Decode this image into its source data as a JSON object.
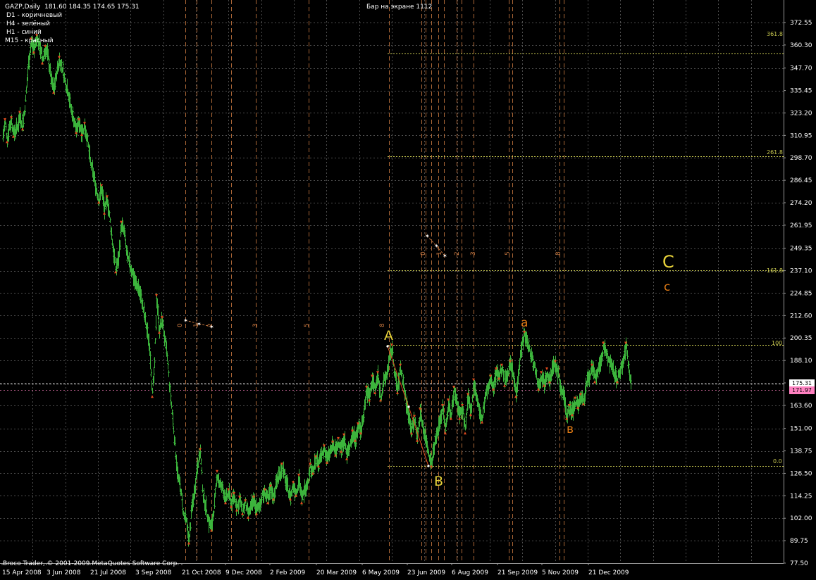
{
  "window": {
    "symbol": "GAZP,Daily",
    "ohlc": "181.60 184.35 174.65 175.31",
    "bars_on_screen": "Бар на экране 1112",
    "watermark": "Broco Trader, © 2001-2009 MetaQuotes Software Corp."
  },
  "legend": [
    {
      "label": "D1 - коричневый"
    },
    {
      "label": "H4 - зелёный"
    },
    {
      "label": "H1 - синий"
    },
    {
      "label": "M15 - красный"
    }
  ],
  "colors": {
    "background": "#000000",
    "grid": "#4d4d4d",
    "bull_bar": "#3cb43c",
    "fractal_marker": "#e04a1e",
    "fib_line": "#c8c850",
    "cycle_line": "#c87840",
    "wave_yellow": "#e8d23a",
    "wave_orange": "#e07a14",
    "current_price_box": "#ffffff",
    "secondary_price_box": "#ff80c0"
  },
  "price_boxes": {
    "current": "175.31",
    "secondary": "171.97"
  },
  "fib_levels": [
    {
      "label": "361.8",
      "price": 355.5
    },
    {
      "label": "261.8",
      "price": 299.5
    },
    {
      "label": "161.8",
      "price": 237.5
    },
    {
      "label": "100",
      "price": 196.5
    },
    {
      "label": "0.0",
      "price": 130.5
    }
  ],
  "wave_labels": [
    {
      "text": "A",
      "style": "big-yellow"
    },
    {
      "text": "B",
      "style": "big-yellow"
    },
    {
      "text": "C",
      "style": "big-yellow"
    },
    {
      "text": "a",
      "style": "small-orange"
    },
    {
      "text": "в",
      "style": "small-orange"
    },
    {
      "text": "c",
      "style": "small-orange"
    }
  ],
  "cycle_numbers_1": [
    "0",
    "1",
    "2",
    "3",
    "5"
  ],
  "cycle_numbers_2": [
    "8"
  ],
  "cycle_numbers_3": [
    "0",
    "1",
    "2",
    "3",
    "5",
    "8"
  ],
  "chart_data": {
    "type": "bar",
    "y_ticks": [
      372.55,
      360.3,
      347.7,
      335.45,
      323.2,
      310.95,
      298.7,
      286.45,
      274.2,
      261.95,
      249.35,
      237.1,
      224.85,
      212.6,
      200.35,
      188.1,
      175.85,
      163.6,
      151.0,
      138.75,
      126.5,
      114.25,
      102.0,
      89.75,
      77.5
    ],
    "x_ticks": [
      "15 Apr 2008",
      "3 Jun 2008",
      "21 Jul 2008",
      "3 Sep 2008",
      "21 Oct 2008",
      "9 Dec 2008",
      "2 Feb 2009",
      "20 Mar 2009",
      "6 May 2009",
      "23 Jun 2009",
      "6 Aug 2009",
      "21 Sep 2009",
      "5 Nov 2009",
      "21 Dec 2009"
    ],
    "ylim": [
      77.5,
      372.55
    ],
    "grid": true,
    "price_path": [
      [
        0,
        311
      ],
      [
        3,
        318
      ],
      [
        6,
        309
      ],
      [
        9,
        316
      ],
      [
        12,
        319
      ],
      [
        15,
        312
      ],
      [
        20,
        315
      ],
      [
        24,
        322
      ],
      [
        28,
        316
      ],
      [
        32,
        330
      ],
      [
        36,
        350
      ],
      [
        40,
        362
      ],
      [
        44,
        358
      ],
      [
        48,
        364
      ],
      [
        52,
        360
      ],
      [
        56,
        352
      ],
      [
        60,
        358
      ],
      [
        64,
        354
      ],
      [
        68,
        342
      ],
      [
        72,
        336
      ],
      [
        76,
        345
      ],
      [
        80,
        352
      ],
      [
        84,
        348
      ],
      [
        88,
        340
      ],
      [
        92,
        336
      ],
      [
        96,
        326
      ],
      [
        100,
        320
      ],
      [
        104,
        314
      ],
      [
        108,
        318
      ],
      [
        112,
        313
      ],
      [
        116,
        316
      ],
      [
        120,
        308
      ],
      [
        124,
        296
      ],
      [
        128,
        290
      ],
      [
        132,
        282
      ],
      [
        136,
        276
      ],
      [
        140,
        282
      ],
      [
        144,
        270
      ],
      [
        148,
        276
      ],
      [
        152,
        264
      ],
      [
        156,
        250
      ],
      [
        160,
        238
      ],
      [
        164,
        244
      ],
      [
        168,
        262
      ],
      [
        172,
        258
      ],
      [
        176,
        245
      ],
      [
        180,
        240
      ],
      [
        184,
        236
      ],
      [
        188,
        230
      ],
      [
        192,
        228
      ],
      [
        196,
        222
      ],
      [
        200,
        214
      ],
      [
        204,
        205
      ],
      [
        208,
        196
      ],
      [
        212,
        170
      ],
      [
        215,
        185
      ],
      [
        218,
        222
      ],
      [
        222,
        205
      ],
      [
        226,
        210
      ],
      [
        230,
        198
      ],
      [
        233,
        190
      ],
      [
        236,
        175
      ],
      [
        240,
        160
      ],
      [
        244,
        142
      ],
      [
        248,
        125
      ],
      [
        252,
        118
      ],
      [
        256,
        104
      ],
      [
        260,
        100
      ],
      [
        264,
        90
      ],
      [
        268,
        108
      ],
      [
        272,
        118
      ],
      [
        276,
        132
      ],
      [
        280,
        138
      ],
      [
        284,
        114
      ],
      [
        288,
        108
      ],
      [
        292,
        100
      ],
      [
        296,
        97
      ],
      [
        300,
        110
      ],
      [
        304,
        126
      ],
      [
        308,
        120
      ],
      [
        312,
        118
      ],
      [
        316,
        112
      ],
      [
        320,
        116
      ],
      [
        324,
        110
      ],
      [
        328,
        114
      ],
      [
        332,
        108
      ],
      [
        336,
        112
      ],
      [
        340,
        106
      ],
      [
        344,
        110
      ],
      [
        348,
        104
      ],
      [
        352,
        108
      ],
      [
        356,
        112
      ],
      [
        360,
        106
      ],
      [
        364,
        110
      ],
      [
        368,
        114
      ],
      [
        372,
        116
      ],
      [
        376,
        112
      ],
      [
        380,
        118
      ],
      [
        384,
        114
      ],
      [
        388,
        122
      ],
      [
        392,
        126
      ],
      [
        396,
        130
      ],
      [
        400,
        124
      ],
      [
        404,
        118
      ],
      [
        408,
        114
      ],
      [
        412,
        120
      ],
      [
        416,
        116
      ],
      [
        420,
        124
      ],
      [
        424,
        112
      ],
      [
        428,
        118
      ],
      [
        432,
        122
      ],
      [
        436,
        130
      ],
      [
        440,
        128
      ],
      [
        444,
        134
      ],
      [
        448,
        132
      ],
      [
        452,
        136
      ],
      [
        456,
        140
      ],
      [
        460,
        134
      ],
      [
        464,
        138
      ],
      [
        468,
        142
      ],
      [
        472,
        138
      ],
      [
        476,
        144
      ],
      [
        480,
        140
      ],
      [
        484,
        146
      ],
      [
        488,
        136
      ],
      [
        492,
        142
      ],
      [
        496,
        148
      ],
      [
        500,
        146
      ],
      [
        504,
        152
      ],
      [
        508,
        150
      ],
      [
        512,
        160
      ],
      [
        516,
        172
      ],
      [
        520,
        168
      ],
      [
        524,
        178
      ],
      [
        528,
        172
      ],
      [
        532,
        180
      ],
      [
        536,
        168
      ],
      [
        540,
        176
      ],
      [
        544,
        180
      ],
      [
        548,
        188
      ],
      [
        552,
        195
      ],
      [
        556,
        180
      ],
      [
        560,
        172
      ],
      [
        564,
        184
      ],
      [
        568,
        176
      ],
      [
        572,
        165
      ],
      [
        576,
        158
      ],
      [
        580,
        150
      ],
      [
        584,
        156
      ],
      [
        588,
        146
      ],
      [
        592,
        160
      ],
      [
        596,
        152
      ],
      [
        600,
        145
      ],
      [
        604,
        138
      ],
      [
        608,
        132
      ],
      [
        612,
        142
      ],
      [
        616,
        148
      ],
      [
        620,
        156
      ],
      [
        624,
        162
      ],
      [
        628,
        150
      ],
      [
        632,
        165
      ],
      [
        636,
        158
      ],
      [
        640,
        172
      ],
      [
        644,
        166
      ],
      [
        648,
        158
      ],
      [
        652,
        162
      ],
      [
        656,
        150
      ],
      [
        660,
        168
      ],
      [
        664,
        160
      ],
      [
        668,
        176
      ],
      [
        672,
        168
      ],
      [
        676,
        160
      ],
      [
        680,
        156
      ],
      [
        684,
        168
      ],
      [
        688,
        172
      ],
      [
        692,
        178
      ],
      [
        696,
        174
      ],
      [
        700,
        182
      ],
      [
        704,
        180
      ],
      [
        708,
        184
      ],
      [
        712,
        176
      ],
      [
        716,
        182
      ],
      [
        720,
        186
      ],
      [
        724,
        180
      ],
      [
        728,
        170
      ],
      [
        732,
        184
      ],
      [
        736,
        196
      ],
      [
        740,
        202
      ],
      [
        744,
        198
      ],
      [
        748,
        192
      ],
      [
        752,
        188
      ],
      [
        756,
        182
      ],
      [
        760,
        174
      ],
      [
        764,
        180
      ],
      [
        768,
        176
      ],
      [
        772,
        182
      ],
      [
        776,
        178
      ],
      [
        780,
        184
      ],
      [
        784,
        186
      ],
      [
        788,
        180
      ],
      [
        792,
        172
      ],
      [
        796,
        168
      ],
      [
        800,
        158
      ],
      [
        804,
        162
      ],
      [
        808,
        160
      ],
      [
        812,
        166
      ],
      [
        816,
        164
      ],
      [
        820,
        168
      ],
      [
        824,
        166
      ],
      [
        828,
        176
      ],
      [
        832,
        180
      ],
      [
        836,
        184
      ],
      [
        840,
        178
      ],
      [
        844,
        182
      ],
      [
        848,
        186
      ],
      [
        852,
        196
      ],
      [
        856,
        192
      ],
      [
        860,
        188
      ],
      [
        864,
        184
      ],
      [
        868,
        180
      ],
      [
        872,
        178
      ],
      [
        876,
        182
      ],
      [
        880,
        188
      ],
      [
        884,
        196
      ],
      [
        888,
        184
      ],
      [
        892,
        176
      ]
    ]
  }
}
